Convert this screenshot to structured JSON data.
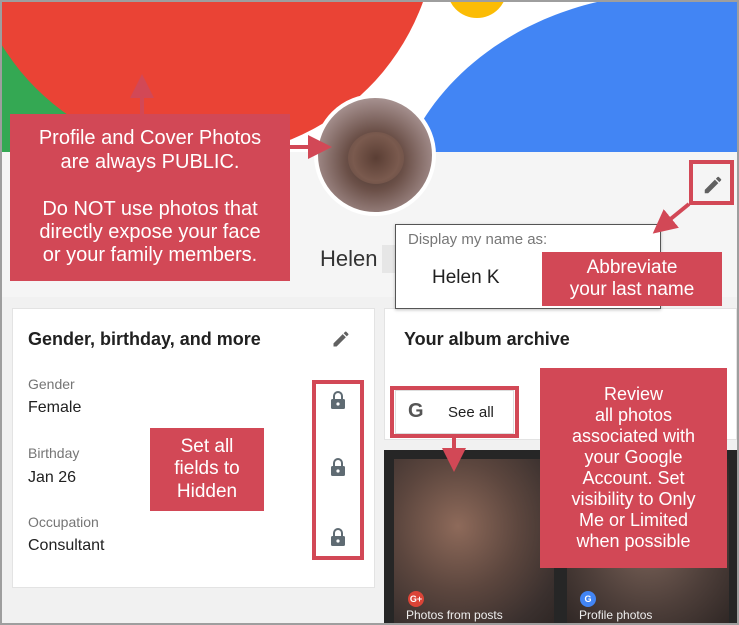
{
  "profile": {
    "name_partial": "Helen",
    "display_name_popup": {
      "label": "Display my name as:",
      "value": "Helen K"
    }
  },
  "about_card": {
    "title": "Gender, birthday, and more",
    "fields": [
      {
        "label": "Gender",
        "value": "Female"
      },
      {
        "label": "Birthday",
        "value": "Jan 26"
      },
      {
        "label": "Occupation",
        "value": "Consultant"
      }
    ]
  },
  "album_card": {
    "title": "Your album archive",
    "see_all_label": "See all",
    "google_g": "G",
    "thumbnails": [
      {
        "caption": "Photos from posts",
        "badge": "G+",
        "badge_color": "#db4437"
      },
      {
        "caption": "Profile photos",
        "badge": "G",
        "badge_color": "#4285f4"
      }
    ]
  },
  "annotations": {
    "profile_photos": "Profile and Cover Photos\nare always PUBLIC.\n\nDo NOT use photos that\ndirectly expose your face\nor your family members.",
    "abbreviate": "Abbreviate\nyour last name",
    "set_hidden": "Set all\nfields to\nHidden",
    "review_photos": "Review\nall photos\nassociated with\nyour Google\nAccount. Set\nvisibility to Only\nMe or Limited\nwhen possible"
  },
  "colors": {
    "annotation_red": "#d24856",
    "cover_red": "#ea4335",
    "cover_green": "#34a853",
    "cover_yellow": "#fbbc05",
    "cover_blue": "#4285f4",
    "icon_gray": "#616161",
    "lock_gray": "#5f6b73"
  }
}
